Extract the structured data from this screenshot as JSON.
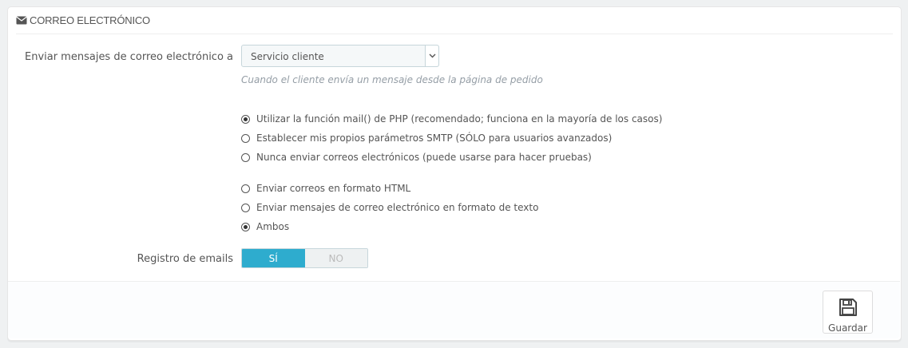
{
  "panel": {
    "title": "Correo electrónico",
    "icon": "envelope-icon"
  },
  "send_to": {
    "label": "Enviar mensajes de correo electrónico a",
    "selected": "Servicio cliente",
    "help": "Cuando el cliente envía un mensaje desde la página de pedido"
  },
  "mail_method": {
    "options": [
      {
        "label": "Utilizar la función mail() de PHP (recomendado; funciona en la mayoría de los casos)",
        "checked": true
      },
      {
        "label": "Establecer mis propios parámetros SMTP (SÓLO para usuarios avanzados)",
        "checked": false
      },
      {
        "label": "Nunca enviar correos electrónicos (puede usarse para hacer pruebas)",
        "checked": false
      }
    ]
  },
  "mail_format": {
    "options": [
      {
        "label": "Enviar correos en formato HTML",
        "checked": false
      },
      {
        "label": "Enviar mensajes de correo electrónico en formato de texto",
        "checked": false
      },
      {
        "label": "Ambos",
        "checked": true
      }
    ]
  },
  "log": {
    "label": "Registro de emails",
    "yes": "SÍ",
    "no": "NO",
    "value": "yes"
  },
  "footer": {
    "save_label": "Guardar",
    "save_icon": "floppy-disk-icon"
  },
  "colors": {
    "accent": "#2eacce"
  }
}
